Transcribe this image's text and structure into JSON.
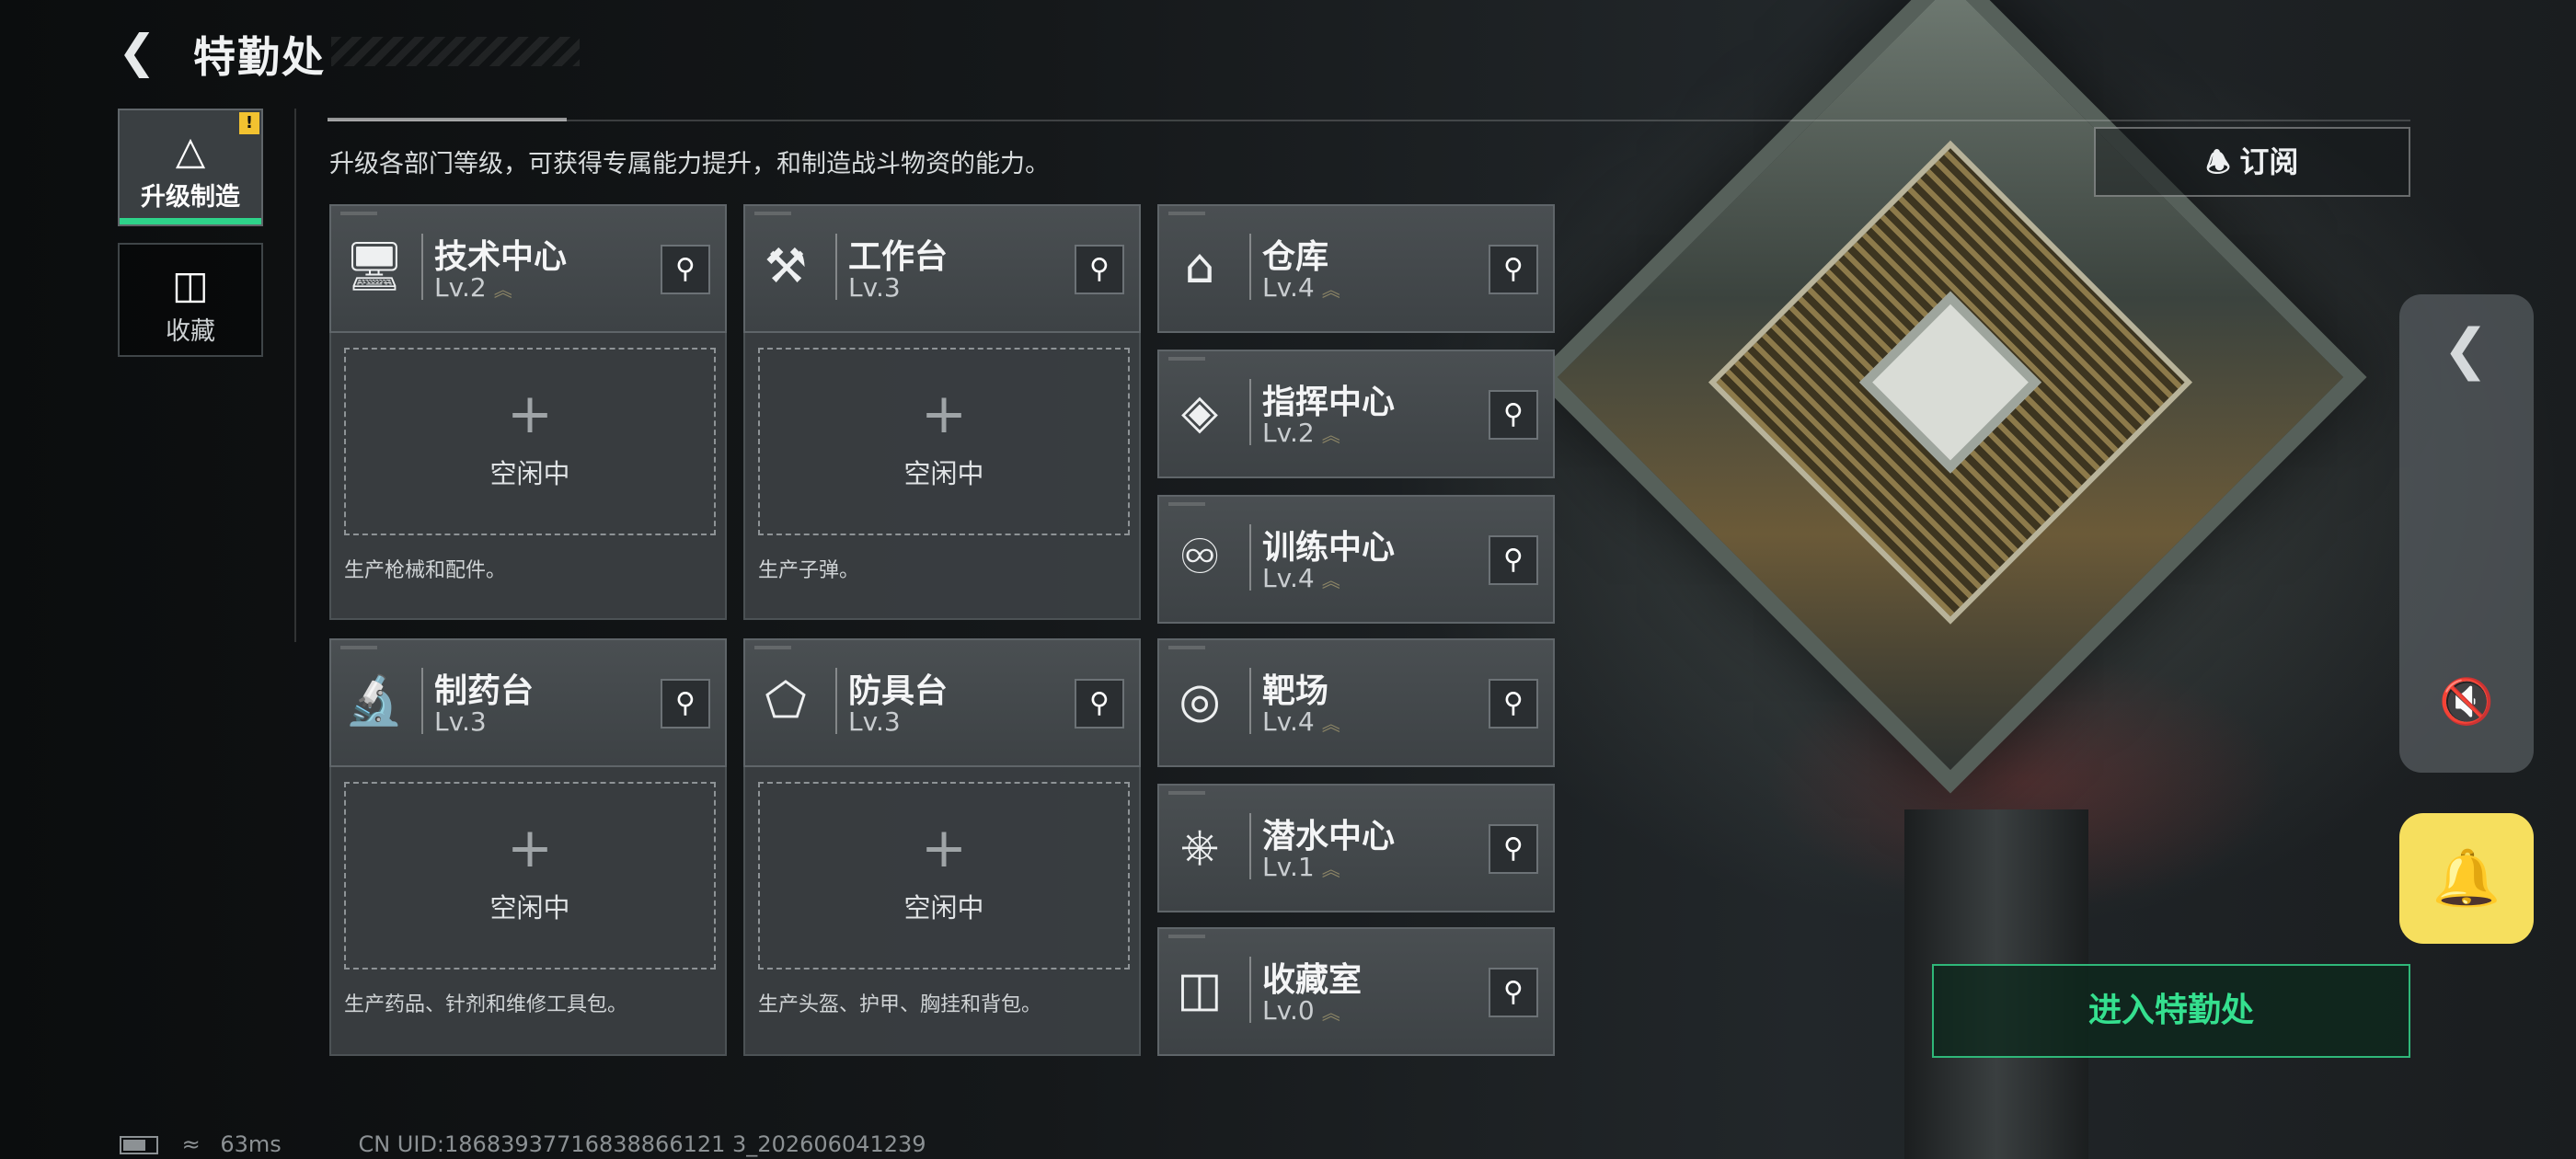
{
  "header": {
    "title": "特勤处",
    "subtitle": "升级各部门等级，可获得专属能力提升，和制造战斗物资的能力。"
  },
  "tabs": [
    {
      "label": "升级制造",
      "icon": "upgrade-icon",
      "active": true,
      "badge": "!"
    },
    {
      "label": "收藏",
      "icon": "trash-bin-icon",
      "active": false
    }
  ],
  "departments": {
    "tech_center": {
      "name": "技术中心",
      "level": "Lv.2",
      "icon": "monitor-icon"
    },
    "workbench": {
      "name": "工作台",
      "level": "Lv.3",
      "icon": "hammer-wrench-icon"
    },
    "warehouse": {
      "name": "仓库",
      "level": "Lv.4",
      "icon": "warehouse-icon"
    },
    "command_center": {
      "name": "指挥中心",
      "level": "Lv.2",
      "icon": "target-diamond-icon"
    },
    "training_center": {
      "name": "训练中心",
      "level": "Lv.4",
      "icon": "dumbbell-icon"
    },
    "pharmacy": {
      "name": "制药台",
      "level": "Lv.3",
      "icon": "microscope-icon"
    },
    "armor_bench": {
      "name": "防具台",
      "level": "Lv.3",
      "icon": "cubes-icon"
    },
    "shooting_range": {
      "name": "靶场",
      "level": "Lv.4",
      "icon": "bullseye-icon"
    },
    "diving_center": {
      "name": "潜水中心",
      "level": "Lv.1",
      "icon": "diving-mask-icon"
    },
    "collection_room": {
      "name": "收藏室",
      "level": "Lv.0",
      "icon": "collection-bin-icon"
    }
  },
  "production_slots": {
    "tech_center": {
      "status": "空闲中",
      "description": "生产枪械和配件。"
    },
    "workbench": {
      "status": "空闲中",
      "description": "生产子弹。"
    },
    "pharmacy": {
      "status": "空闲中",
      "description": "生产药品、针剂和维修工具包。"
    },
    "armor_bench": {
      "status": "空闲中",
      "description": "生产头盔、护甲、胸挂和背包。"
    }
  },
  "right_panel": {
    "subscribe_label": "订阅",
    "enter_label": "进入特勤处"
  },
  "status_bar": {
    "ping": "63ms",
    "uid": "CN UID:18683937716838866121 3_202606041239"
  },
  "colors": {
    "accent_green": "#35e08f",
    "bell_yellow": "#f6df5e",
    "warn_yellow": "#f2c230"
  }
}
